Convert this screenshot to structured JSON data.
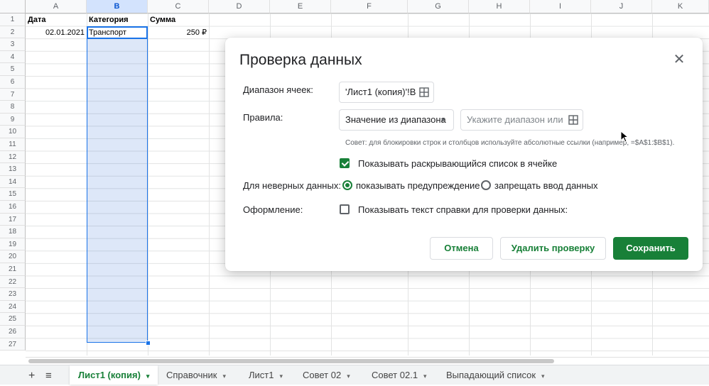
{
  "sheet": {
    "columns": [
      "A",
      "B",
      "C",
      "D",
      "E",
      "F",
      "G",
      "H",
      "I",
      "J",
      "K"
    ],
    "selected_column": "B",
    "rows": [
      "1",
      "2",
      "3",
      "4",
      "5",
      "6",
      "7",
      "8",
      "9",
      "10",
      "11",
      "12",
      "13",
      "14",
      "15",
      "16",
      "17",
      "18",
      "19",
      "20",
      "21",
      "22",
      "23",
      "24",
      "25",
      "26",
      "27"
    ],
    "headers": {
      "a1": "Дата",
      "b1": "Категория",
      "c1": "Сумма"
    },
    "row2": {
      "a2": "02.01.2021",
      "b2": "Транспорт",
      "c2": "250 ₽"
    }
  },
  "tabs": {
    "add_icon": "plus-icon",
    "menu_icon": "list-icon",
    "items": [
      {
        "label": "Лист1 (копия)",
        "active": true
      },
      {
        "label": "Справочник"
      },
      {
        "label": "Лист1"
      },
      {
        "label": "Совет 02"
      },
      {
        "label": "Совет 02.1"
      },
      {
        "label": "Выпадающий список"
      }
    ],
    "arrow": "▾"
  },
  "dialog": {
    "title": "Проверка данных",
    "close": "✕",
    "range_label": "Диапазон ячеек:",
    "range_value": "'Лист1 (копия)'!B",
    "rules_label": "Правила:",
    "rule_type": "Значение из диапазона",
    "rule_range_placeholder": "Укажите диапазон или",
    "hint": "Совет: для блокировки строк и столбцов используйте абсолютные ссылки (например, =$A$1:$B$1).",
    "show_dropdown_label": "Показывать раскрывающийся список в ячейке",
    "show_dropdown_checked": true,
    "invalid_label": "Для неверных данных:",
    "invalid_options": [
      "показывать предупреждение",
      "запрещать ввод данных"
    ],
    "invalid_selected": 0,
    "appearance_label": "Оформление:",
    "help_text_label": "Показывать текст справки для проверки данных:",
    "help_text_checked": false,
    "cancel": "Отмена",
    "remove": "Удалить проверку",
    "save": "Сохранить"
  },
  "colors": {
    "accent": "#188038",
    "selection": "#1a73e8"
  }
}
